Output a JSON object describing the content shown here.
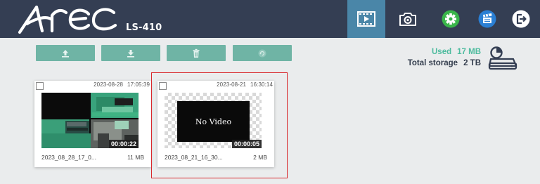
{
  "header": {
    "brand": "Arec",
    "model": "LS-410",
    "nav": [
      {
        "name": "playback",
        "active": true
      },
      {
        "name": "snapshot",
        "active": false
      },
      {
        "name": "settings",
        "active": false
      },
      {
        "name": "clapperboard",
        "active": false
      },
      {
        "name": "logout",
        "active": false
      }
    ]
  },
  "toolbar": {
    "buttons": [
      "upload-icon",
      "download-icon",
      "trash-icon",
      "refresh-icon"
    ]
  },
  "storage": {
    "used_label": "Used",
    "used_value": "17 MB",
    "total_label": "Total storage",
    "total_value": "2 TB"
  },
  "recordings": [
    {
      "date": "2023-08-28",
      "time": "17:05:39",
      "duration": "00:00:22",
      "filename": "2023_08_28_17_0...",
      "size": "11 MB",
      "checked": false,
      "thumbnail": "video-frame"
    },
    {
      "date": "2023-08-21",
      "time": "16:30:14",
      "duration": "00:00:05",
      "filename": "2023_08_21_16_30...",
      "size": "2 MB",
      "checked": false,
      "thumbnail": "no-video",
      "thumbnail_text": "No Video",
      "highlighted": true
    }
  ],
  "colors": {
    "header_bg": "#343e53",
    "active_tab": "#4a86a8",
    "toolbar_button": "#6fb4a5",
    "used_text": "#4dbb9e",
    "settings_icon": "#39b54a",
    "clapper_icon": "#2a7fd4",
    "highlight_border": "#d8282c"
  }
}
